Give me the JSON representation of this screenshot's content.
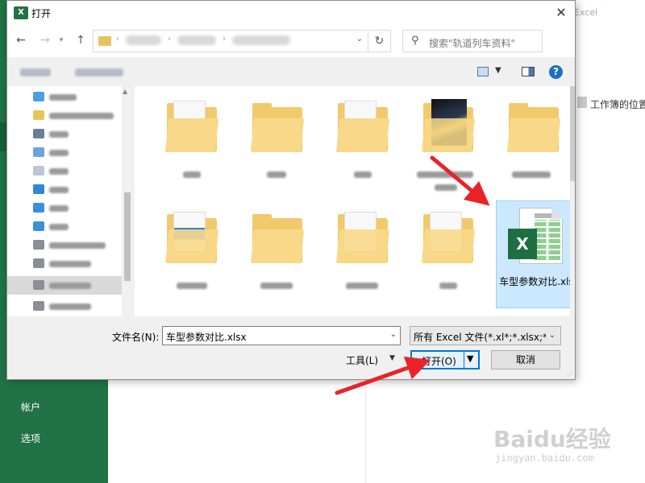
{
  "backstage": {
    "app_title": "Excel",
    "recent_hint": "工作簿的位置",
    "account_label": "帐户",
    "options_label": "选项",
    "accent_color": "#217346"
  },
  "dialog": {
    "title": "打开",
    "title_icon": "excel-icon",
    "close_symbol": "✕",
    "search_placeholder": "搜索\"轨道列车资料\"",
    "files": [
      {
        "name": "车型参数对比.xlsx",
        "type": "xlsx",
        "selected": true
      }
    ],
    "filename_label": "文件名(N):",
    "filename_value": "车型参数对比.xlsx",
    "filetype_value": "所有 Excel 文件(*.xl*;*.xlsx;*.xl",
    "tools_label": "工具(L)",
    "open_label": "打开(O)",
    "cancel_label": "取消",
    "help_symbol": "?"
  },
  "watermark": {
    "logo": "Baidu经验",
    "sub": "jingyan.baidu.com"
  },
  "annotation_color": "#e8232a"
}
